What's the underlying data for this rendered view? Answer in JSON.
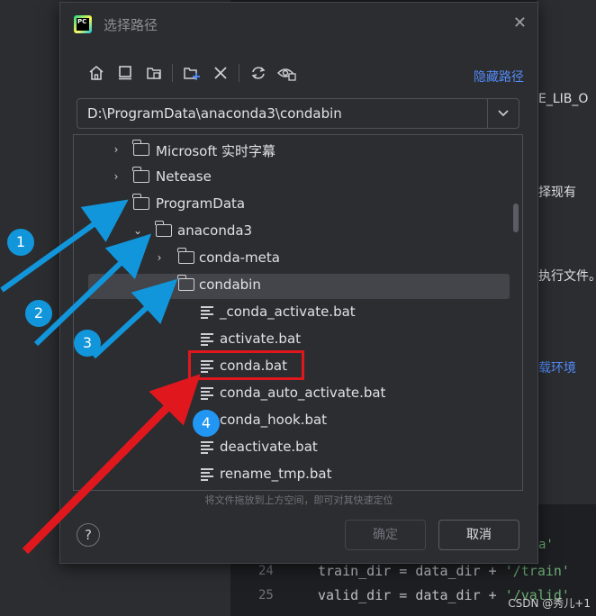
{
  "background": {
    "code_lines": [
      {
        "num": "24",
        "code_a": "train_dir = data_dir + ",
        "code_str": "'/train'"
      },
      {
        "num": "25",
        "code_a": "valid_dir = data_dir + ",
        "code_str": "'/valid'"
      }
    ],
    "peek_texts": [
      "E_LIB_O",
      "择现有",
      "执行文件。",
      "载环境",
      "a'"
    ],
    "watermark": "CSDN @秀儿+1"
  },
  "dialog": {
    "title": "选择路径",
    "hide_path_link": "隐藏路径",
    "path_value": "D:\\ProgramData\\anaconda3\\condabin",
    "tree": [
      {
        "label": "Microsoft 实时字幕",
        "type": "folder",
        "expanded": false
      },
      {
        "label": "Netease",
        "type": "folder",
        "expanded": false
      },
      {
        "label": "ProgramData",
        "type": "folder",
        "expanded": true
      },
      {
        "label": "anaconda3",
        "type": "folder",
        "expanded": true
      },
      {
        "label": "conda-meta",
        "type": "folder",
        "expanded": false
      },
      {
        "label": "condabin",
        "type": "folder",
        "expanded": true,
        "selected": true
      },
      {
        "label": "_conda_activate.bat",
        "type": "file"
      },
      {
        "label": "activate.bat",
        "type": "file"
      },
      {
        "label": "conda.bat",
        "type": "file",
        "highlighted": true
      },
      {
        "label": "conda_auto_activate.bat",
        "type": "file"
      },
      {
        "label": "conda_hook.bat",
        "type": "file"
      },
      {
        "label": "deactivate.bat",
        "type": "file"
      },
      {
        "label": "rename_tmp.bat",
        "type": "file"
      }
    ],
    "drag_hint": "将文件拖放到上方空间，即可对其快速定位",
    "ok_label": "确定",
    "cancel_label": "取消",
    "help_label": "?"
  },
  "annotations": {
    "badges": [
      "1",
      "2",
      "3",
      "4"
    ],
    "arrow_color": "#1296db",
    "highlight_color": "#e0181e"
  },
  "colors": {
    "accent_link": "#548af7",
    "dialog_bg": "#2b2d30",
    "editor_bg": "#1e1f22"
  }
}
